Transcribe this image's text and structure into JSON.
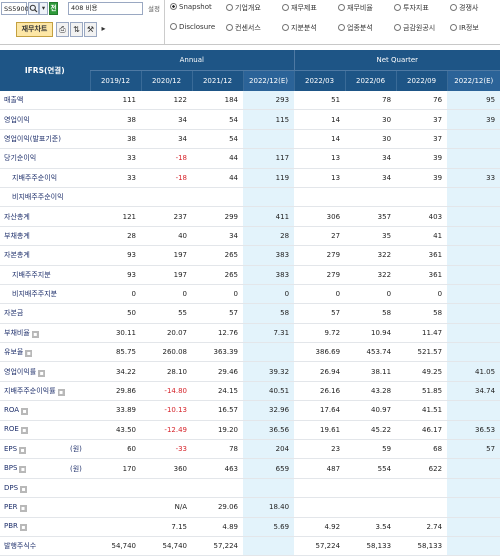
{
  "toolbar": {
    "code_value": "SS5900",
    "search_icon": "search-icon",
    "dropdown_icon": "chevron-down-icon",
    "jeon_label": "전",
    "name_value": "408 비용",
    "config_label": "설정",
    "main_button_label": "재무차트",
    "radios": [
      {
        "label": "Snapshot",
        "selected": true
      },
      {
        "label": "기업개요",
        "selected": false
      },
      {
        "label": "재무제표",
        "selected": false
      },
      {
        "label": "재무비율",
        "selected": false
      },
      {
        "label": "투자지표",
        "selected": false
      },
      {
        "label": "경쟁사",
        "selected": false
      },
      {
        "label": "Disclosure",
        "selected": false
      },
      {
        "label": "컨센서스",
        "selected": false
      },
      {
        "label": "지분분석",
        "selected": false
      },
      {
        "label": "업종분석",
        "selected": false
      },
      {
        "label": "금감원공시",
        "selected": false
      },
      {
        "label": "IR정보",
        "selected": false
      }
    ]
  },
  "table": {
    "corner_label": "IFRS(연결)",
    "group_annual": "Annual",
    "group_quarter": "Net Quarter",
    "periods": [
      "2019/12",
      "2020/12",
      "2021/12",
      "2022/12(E)",
      "2022/03",
      "2022/06",
      "2022/09",
      "2022/12(E)"
    ],
    "estimate_columns": [
      3,
      7
    ],
    "rows": [
      {
        "label": "매출액",
        "unit": "",
        "icon": false,
        "values": [
          "111",
          "122",
          "184",
          "293",
          "51",
          "78",
          "76",
          "95"
        ]
      },
      {
        "label": "영업이익",
        "unit": "",
        "icon": false,
        "values": [
          "38",
          "34",
          "54",
          "115",
          "14",
          "30",
          "37",
          "39"
        ]
      },
      {
        "label": "영업이익(발표기준)",
        "unit": "",
        "icon": false,
        "values": [
          "38",
          "34",
          "54",
          "",
          "14",
          "30",
          "37",
          ""
        ]
      },
      {
        "label": "당기순이익",
        "unit": "",
        "icon": false,
        "values": [
          "33",
          "-18",
          "44",
          "117",
          "13",
          "34",
          "39",
          ""
        ]
      },
      {
        "label": "지배주주순이익",
        "unit": "",
        "icon": false,
        "indent": true,
        "values": [
          "33",
          "-18",
          "44",
          "119",
          "13",
          "34",
          "39",
          "33"
        ]
      },
      {
        "label": "비지배주주순이익",
        "unit": "",
        "icon": false,
        "indent": true,
        "values": [
          "",
          "",
          "",
          "",
          "",
          "",
          "",
          ""
        ]
      },
      {
        "label": "자산총계",
        "unit": "",
        "icon": false,
        "values": [
          "121",
          "237",
          "299",
          "411",
          "306",
          "357",
          "403",
          ""
        ]
      },
      {
        "label": "부채총계",
        "unit": "",
        "icon": false,
        "values": [
          "28",
          "40",
          "34",
          "28",
          "27",
          "35",
          "41",
          ""
        ]
      },
      {
        "label": "자본총계",
        "unit": "",
        "icon": false,
        "values": [
          "93",
          "197",
          "265",
          "383",
          "279",
          "322",
          "361",
          ""
        ]
      },
      {
        "label": "지배주주지분",
        "unit": "",
        "icon": false,
        "indent": true,
        "values": [
          "93",
          "197",
          "265",
          "383",
          "279",
          "322",
          "361",
          ""
        ]
      },
      {
        "label": "비지배주주지분",
        "unit": "",
        "icon": false,
        "indent": true,
        "values": [
          "0",
          "0",
          "0",
          "0",
          "0",
          "0",
          "0",
          ""
        ]
      },
      {
        "label": "자본금",
        "unit": "",
        "icon": false,
        "values": [
          "50",
          "55",
          "57",
          "58",
          "57",
          "58",
          "58",
          ""
        ]
      },
      {
        "label": "부채비율",
        "unit": "",
        "icon": true,
        "values": [
          "30.11",
          "20.07",
          "12.76",
          "7.31",
          "9.72",
          "10.94",
          "11.47",
          ""
        ]
      },
      {
        "label": "유보율",
        "unit": "",
        "icon": true,
        "values": [
          "85.75",
          "260.08",
          "363.39",
          "",
          "386.69",
          "453.74",
          "521.57",
          ""
        ]
      },
      {
        "label": "영업이익률",
        "unit": "",
        "icon": true,
        "values": [
          "34.22",
          "28.10",
          "29.46",
          "39.32",
          "26.94",
          "38.11",
          "49.25",
          "41.05"
        ]
      },
      {
        "label": "지배주주순이익률",
        "unit": "",
        "icon": true,
        "values": [
          "29.86",
          "-14.80",
          "24.15",
          "40.51",
          "26.16",
          "43.28",
          "51.85",
          "34.74"
        ]
      },
      {
        "label": "ROA",
        "unit": "",
        "icon": true,
        "values": [
          "33.89",
          "-10.13",
          "16.57",
          "32.96",
          "17.64",
          "40.97",
          "41.51",
          ""
        ]
      },
      {
        "label": "ROE",
        "unit": "",
        "icon": true,
        "values": [
          "43.50",
          "-12.49",
          "19.20",
          "36.56",
          "19.61",
          "45.22",
          "46.17",
          "36.53"
        ]
      },
      {
        "label": "EPS",
        "unit": "(원)",
        "icon": true,
        "values": [
          "60",
          "-33",
          "78",
          "204",
          "23",
          "59",
          "68",
          "57"
        ]
      },
      {
        "label": "BPS",
        "unit": "(원)",
        "icon": true,
        "values": [
          "170",
          "360",
          "463",
          "659",
          "487",
          "554",
          "622",
          ""
        ]
      },
      {
        "label": "DPS",
        "unit": "",
        "icon": true,
        "values": [
          "",
          "",
          "",
          "",
          "",
          "",
          "",
          ""
        ]
      },
      {
        "label": "PER",
        "unit": "",
        "icon": true,
        "values": [
          "",
          "N/A",
          "29.06",
          "18.40",
          "",
          "",
          "",
          ""
        ]
      },
      {
        "label": "PBR",
        "unit": "",
        "icon": true,
        "values": [
          "",
          "7.15",
          "4.89",
          "5.69",
          "4.92",
          "3.54",
          "2.74",
          ""
        ]
      },
      {
        "label": "발행주식수",
        "unit": "",
        "icon": false,
        "values": [
          "54,740",
          "54,740",
          "57,224",
          "",
          "57,224",
          "58,133",
          "58,133",
          ""
        ]
      }
    ]
  }
}
